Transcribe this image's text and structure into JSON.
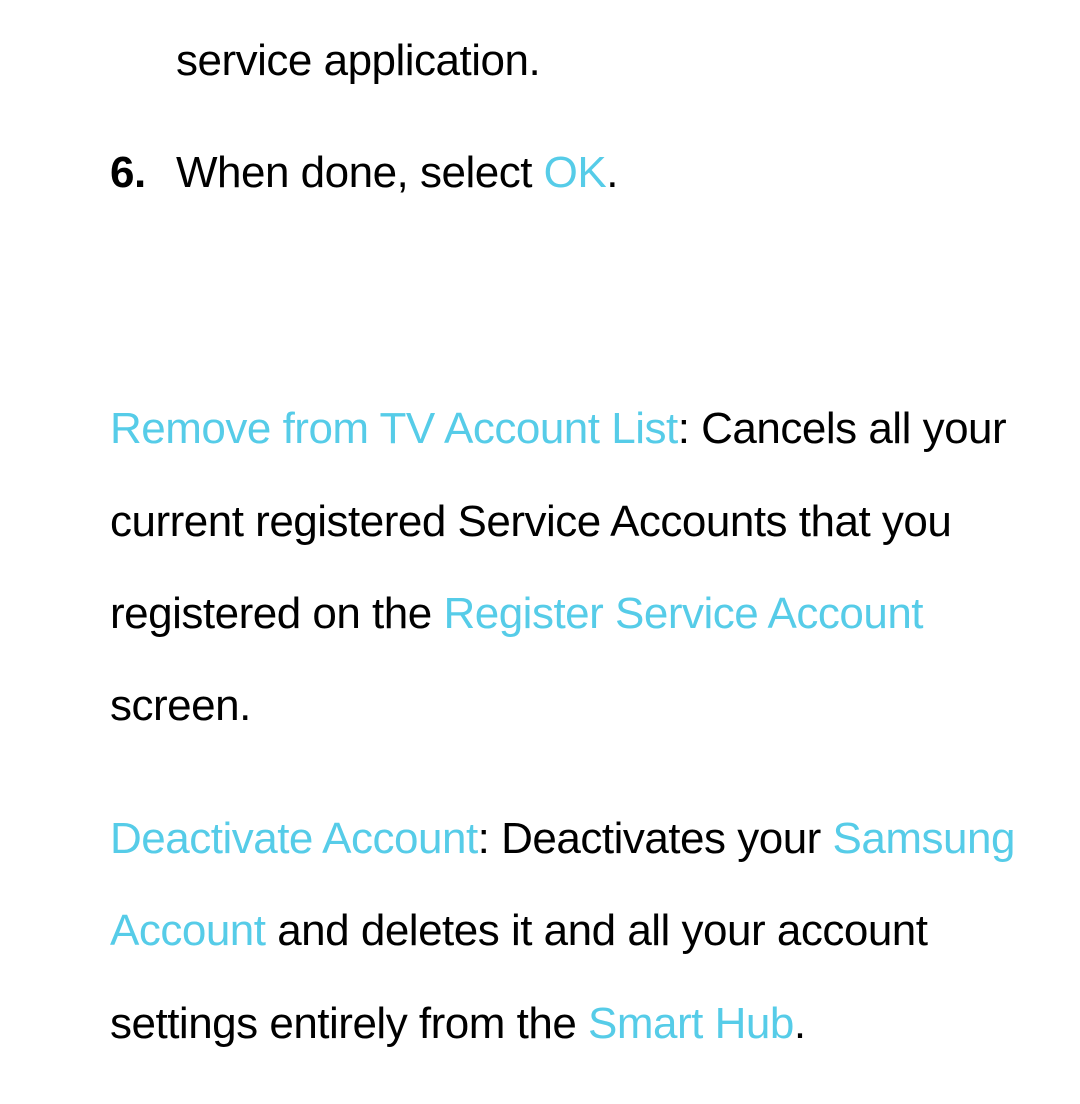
{
  "continuedLine": "service application.",
  "step6": {
    "number": "6.",
    "prefix": "When done, select ",
    "highlight": "OK",
    "suffix": "."
  },
  "para1": {
    "hl1": "Remove from TV Account List",
    "txt1": ": Cancels all your current registered Service Accounts that you registered on the ",
    "hl2": "Register Service Account",
    "txt2": " screen."
  },
  "para2": {
    "hl1": "Deactivate Account",
    "txt1": ": Deactivates your ",
    "hl2": "Samsung Account",
    "txt2": " and deletes it and all your account settings entirely from the ",
    "hl3": "Smart Hub",
    "txt3": "."
  }
}
